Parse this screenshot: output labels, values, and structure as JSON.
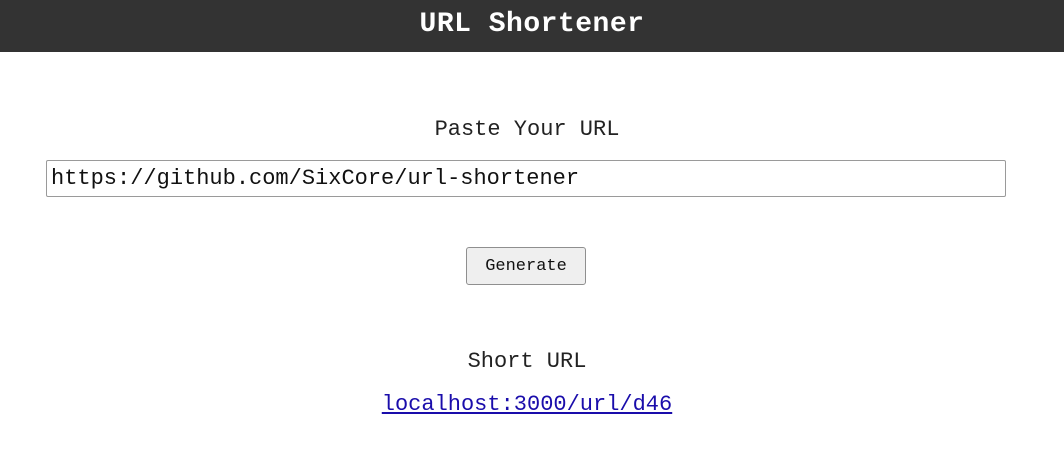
{
  "header": {
    "title": "URL Shortener"
  },
  "form": {
    "label": "Paste Your URL",
    "url_value": "https://github.com/SixCore/url-shortener",
    "generate_label": "Generate"
  },
  "result": {
    "label": "Short URL",
    "link_text": "localhost:3000/url/d46",
    "link_href": "#"
  },
  "colors": {
    "header_bg": "#333333",
    "link": "#1a0dab"
  }
}
